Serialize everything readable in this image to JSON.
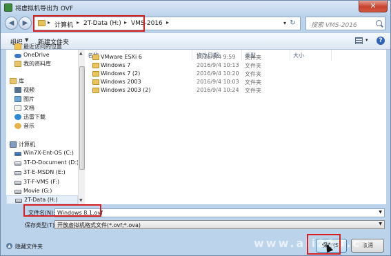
{
  "window": {
    "title": "将虚拟机导出为 OVF",
    "close_label": "✕"
  },
  "address": {
    "segments": [
      "计算机",
      "2T-Data (H:)",
      "VMS-2016"
    ],
    "separator": "▸",
    "dropdown": "▾",
    "refresh": "↻"
  },
  "search": {
    "placeholder": "搜索 VMS-2016"
  },
  "toolbar": {
    "organize_label": "组织",
    "organize_caret": "▼",
    "new_folder_label": "新建文件夹",
    "view_caret": "▾",
    "help_label": "?"
  },
  "nav": {
    "favorites": [
      "最近访问的位置",
      "OneDrive",
      "我的资料库"
    ],
    "libraries_header": "库",
    "libraries": [
      "视频",
      "图片",
      "文档",
      "迅雷下载",
      "音乐"
    ],
    "computer_header": "计算机",
    "drives": [
      "Win7X-Ent-OS (C:)",
      "3T-D-Document (D:)",
      "3T-E-MSDN (E:)",
      "3T-F-VMS (F:)",
      "Movie (G:)",
      "2T-Data (H:)"
    ]
  },
  "filelist": {
    "columns": [
      "名称",
      "修改日期",
      "类型",
      "大小"
    ],
    "rows": [
      {
        "name": "VMware ESXi 6",
        "date": "2016/9/4 9:59",
        "type": "文件夹"
      },
      {
        "name": "Windows 7",
        "date": "2016/9/4 10:13",
        "type": "文件夹"
      },
      {
        "name": "Windows 7 (2)",
        "date": "2016/9/4 10:20",
        "type": "文件夹"
      },
      {
        "name": "Windows 2003",
        "date": "2016/9/4 10:03",
        "type": "文件夹"
      },
      {
        "name": "Windows 2003 (2)",
        "date": "2016/9/4 10:24",
        "type": "文件夹"
      }
    ]
  },
  "form": {
    "filename_label": "文件名(N):",
    "filename_value": "Windows 8.1.ovf",
    "filetype_label": "保存类型(T):",
    "filetype_value": "开放虚拟机格式文件(*.ovf;*.ova)",
    "dropdown": "▼"
  },
  "footer": {
    "hide_folders_label": "隐藏文件夹",
    "save_label": "保存(S)",
    "cancel_label": "取消",
    "watermark": "www.ali213.cn"
  }
}
